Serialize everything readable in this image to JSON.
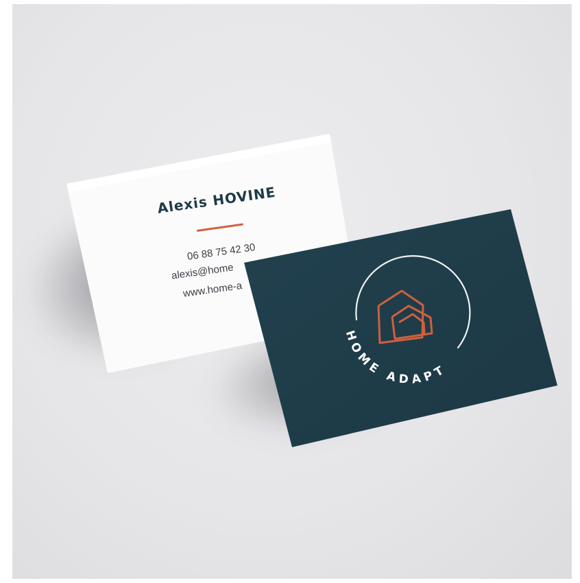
{
  "card_back": {
    "name": "Alexis HOVINE",
    "phone": "06 88 75 42 30",
    "email": "alexis@home",
    "website": "www.home-a"
  },
  "card_front": {
    "brand": "HOME ADAPT",
    "logo_icon": "house-outline-icon"
  },
  "colors": {
    "background": "#e6e6e8",
    "card_dark": "#1f3d4a",
    "accent": "#d0603e",
    "text_dark": "#1d3a47"
  }
}
